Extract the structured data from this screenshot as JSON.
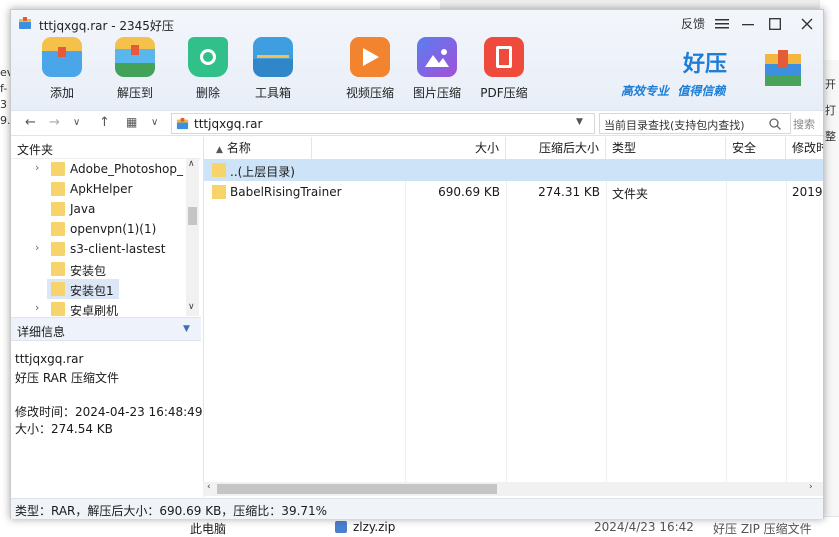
{
  "background": {
    "left_fragments": [
      "ev",
      "f-",
      "3",
      "9.j"
    ],
    "right_fragments": [
      "开",
      "打",
      "整"
    ],
    "bottom_left": "此电脑",
    "bottom_file": "zlzy.zip",
    "bottom_date": "2024/4/23 16:42",
    "bottom_type": "好压 ZIP 压缩文件"
  },
  "window": {
    "title": "tttjqxgq.rar - 2345好压",
    "feedback": "反馈",
    "menu_icon": "hamburger-icon",
    "minimize_icon": "minimize-icon",
    "maximize_icon": "maximize-icon",
    "close_icon": "close-icon"
  },
  "toolbar": {
    "items": [
      {
        "label": "添加",
        "icon": "add-icon",
        "color": "#4aa6e8"
      },
      {
        "label": "解压到",
        "icon": "extract-icon",
        "color": "#5ab7ee"
      },
      {
        "label": "删除",
        "icon": "recycle-icon",
        "color": "#32c08a"
      },
      {
        "label": "工具箱",
        "icon": "toolbox-icon",
        "color": "#3e9ee0"
      },
      {
        "label": "视频压缩",
        "icon": "video-compress-icon",
        "color": "#f2832f"
      },
      {
        "label": "图片压缩",
        "icon": "image-compress-icon",
        "color": "#8a5ad8"
      },
      {
        "label": "PDF压缩",
        "icon": "pdf-compress-icon",
        "color": "#ee4b3d"
      }
    ],
    "brand_name": "好压",
    "brand_slogan": "高效专业  值得信赖",
    "brand_color": "#1e7ed6"
  },
  "navbar": {
    "path": "tttjqxgq.rar",
    "search_placeholder": "当前目录查找(支持包内查找)",
    "search_button": "搜索"
  },
  "folders": {
    "header": "文件夹",
    "items": [
      {
        "label": "Adobe_Photoshop_",
        "expandable": true
      },
      {
        "label": "ApkHelper",
        "expandable": false
      },
      {
        "label": "Java",
        "expandable": false
      },
      {
        "label": "openvpn(1)(1)",
        "expandable": false
      },
      {
        "label": "s3-client-lastest",
        "expandable": true
      },
      {
        "label": "安装包",
        "expandable": false
      },
      {
        "label": "安装包1",
        "expandable": false,
        "selected": true
      },
      {
        "label": "安卓刷机",
        "expandable": true
      }
    ]
  },
  "details": {
    "header": "详细信息",
    "filename": "tttjqxgq.rar",
    "filetype": "好压 RAR 压缩文件",
    "modified": "修改时间：2024-04-23 16:48:49",
    "size": "大小：274.54 KB"
  },
  "filelist": {
    "columns": [
      "名称",
      "大小",
      "压缩后大小",
      "类型",
      "安全",
      "修改时"
    ],
    "rows": [
      {
        "name": "..(上层目录)",
        "size": "",
        "packed": "",
        "type": "",
        "safe": "",
        "modified": "",
        "selected": true
      },
      {
        "name": "BabelRisingTrainer",
        "size": "690.69 KB",
        "packed": "274.31 KB",
        "type": "文件夹",
        "safe": "",
        "modified": "2019-",
        "selected": false
      }
    ]
  },
  "status": {
    "text": "类型：RAR，解压后大小：690.69 KB，压缩比：39.71%"
  }
}
